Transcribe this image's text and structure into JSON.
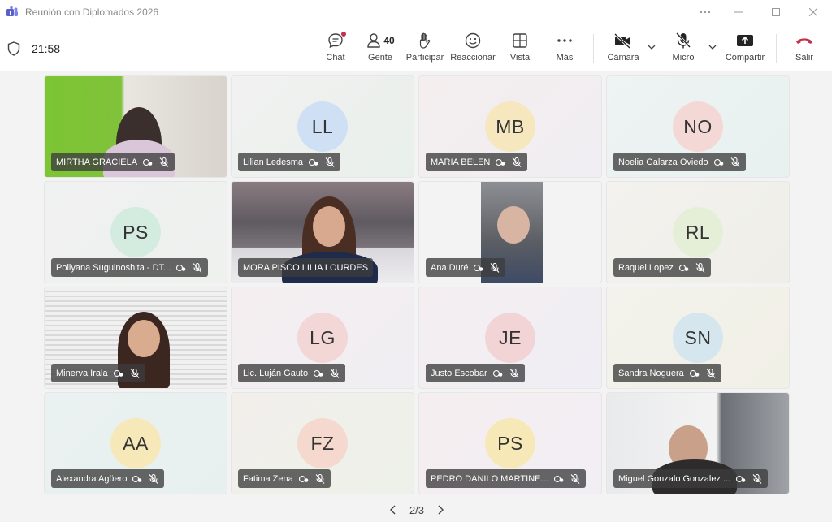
{
  "window": {
    "title": "Reunión con Diplomados 2026"
  },
  "toolbar": {
    "timer": "21:58",
    "chat": "Chat",
    "people": "Gente",
    "people_count": "40",
    "participate": "Participar",
    "react": "Reaccionar",
    "view": "Vista",
    "more": "Más",
    "camera": "Cámara",
    "mic": "Micro",
    "share": "Compartir",
    "leave": "Salir"
  },
  "participants": [
    {
      "name": "MIRTHA GRACIELA",
      "initials": "",
      "type": "video"
    },
    {
      "name": "Lilian Ledesma",
      "initials": "LL",
      "type": "avatar",
      "color": "#cfe0f5"
    },
    {
      "name": "MARIA BELEN",
      "initials": "MB",
      "type": "avatar",
      "color": "#f7e7bf"
    },
    {
      "name": "Noelia Galarza Oviedo",
      "initials": "NO",
      "type": "avatar",
      "color": "#f4d8d6"
    },
    {
      "name": "Pollyana Suguinoshita - DT...",
      "initials": "PS",
      "type": "avatar",
      "color": "#d3ecdf"
    },
    {
      "name": "MORA PISCO LILIA LOURDES",
      "initials": "",
      "type": "video"
    },
    {
      "name": "Ana Duré",
      "initials": "",
      "type": "video"
    },
    {
      "name": "Raquel Lopez",
      "initials": "RL",
      "type": "avatar",
      "color": "#e5efd8"
    },
    {
      "name": "Minerva Irala",
      "initials": "",
      "type": "video"
    },
    {
      "name": "Lic. Luján Gauto",
      "initials": "LG",
      "type": "avatar",
      "color": "#f3d6d6"
    },
    {
      "name": "Justo Escobar",
      "initials": "JE",
      "type": "avatar",
      "color": "#f2d3d6"
    },
    {
      "name": "Sandra Noguera",
      "initials": "SN",
      "type": "avatar",
      "color": "#d5e6ee"
    },
    {
      "name": "Alexandra Agüero",
      "initials": "AA",
      "type": "avatar",
      "color": "#f6e8b8"
    },
    {
      "name": "Fatima Zena",
      "initials": "FZ",
      "type": "avatar",
      "color": "#f5d9cf"
    },
    {
      "name": "PEDRO DANILO MARTINE...",
      "initials": "PS",
      "type": "avatar",
      "color": "#f7e8b8"
    },
    {
      "name": "Miguel Gonzalo Gonzalez ...",
      "initials": "",
      "type": "video"
    }
  ],
  "pager": {
    "label": "2/3"
  },
  "colors": {
    "leave": "#c4314b",
    "accent": "#5b5fc7",
    "notify": "#c4314b"
  }
}
